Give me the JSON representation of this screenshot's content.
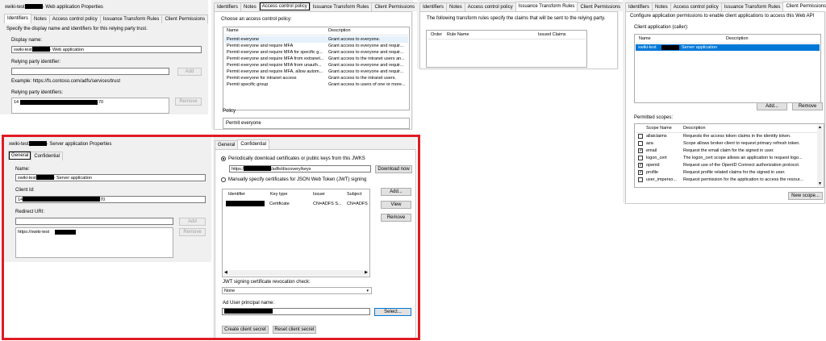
{
  "webapp": {
    "title_prefix": "xwiki-test",
    "title_suffix": "- Web application Properties",
    "tabs": [
      "Identifiers",
      "Notes",
      "Access control policy",
      "Issuance Transform Rules",
      "Client Permissions"
    ],
    "intro": "Specify the display name and identifiers for this relying party trust.",
    "display_name_label": "Display name:",
    "display_name_prefix": "xwiki-test",
    "display_name_suffix": "- Web application",
    "rp_identifier_label": "Relying party identifier:",
    "add_label": "Add",
    "example": "Example: https://fs.contoso.com/adfs/services/trust",
    "rp_identifiers_label": "Relying party identifiers:",
    "id_prefix": "14",
    "id_suffix": "70",
    "remove_label": "Remove"
  },
  "acp": {
    "tabs": [
      "Identifiers",
      "Notes",
      "Access control policy",
      "Issuance Transform Rules",
      "Client Permissions"
    ],
    "choose": "Choose an access control policy:",
    "col_name": "Name",
    "col_desc": "Description",
    "rows": [
      {
        "name": "Permit everyone",
        "desc": "Grant access to everyone."
      },
      {
        "name": "Permit everyone and require MFA",
        "desc": "Grant access to everyone and requir..."
      },
      {
        "name": "Permit everyone and require MFA for specific g...",
        "desc": "Grant access to everyone and requir..."
      },
      {
        "name": "Permit everyone and require MFA from extranet...",
        "desc": "Grant access to the intranet users an..."
      },
      {
        "name": "Permit everyone and require MFA from unauth...",
        "desc": "Grant access to everyone and requir..."
      },
      {
        "name": "Permit everyone and require MFA, allow autom...",
        "desc": "Grant access to everyone and requir..."
      },
      {
        "name": "Permit everyone for intranet access",
        "desc": "Grant access to the intranet users."
      },
      {
        "name": "Permit specific group",
        "desc": "Grant access to users of one or more..."
      }
    ],
    "policy_label": "Policy",
    "policy_value": "Permit everyone"
  },
  "itr": {
    "tabs": [
      "Identifiers",
      "Notes",
      "Access control policy",
      "Issuance Transform Rules",
      "Client Permissions"
    ],
    "intro": "The following transform rules specify the claims that will be sent to the relying party.",
    "col_order": "Order",
    "col_rule": "Rule Name",
    "col_claims": "Issued Claims"
  },
  "cp": {
    "tabs": [
      "Identifiers",
      "Notes",
      "Access control policy",
      "Issuance Transform Rules",
      "Client Permissions"
    ],
    "intro": "Configure application permissions to enable client applications to access this Web API",
    "client_label": "Client application (caller):",
    "col_name": "Name",
    "col_desc": "Description",
    "client_prefix": "xwiki-test",
    "client_suffix": "Server application",
    "add_label": "Add...",
    "remove_label": "Remove",
    "scopes_label": "Permitted scopes:",
    "col_scope": "Scope Name",
    "scopes": [
      {
        "name": "allatclaims",
        "desc": "Requests the access token claims in the identity token.",
        "checked": false
      },
      {
        "name": "aza",
        "desc": "Scope allows broker client to request primary refresh token.",
        "checked": false
      },
      {
        "name": "email",
        "desc": "Request the email claim for the signed in user.",
        "checked": true
      },
      {
        "name": "logon_cert",
        "desc": "The logon_cert scope allows an application to request logo...",
        "checked": false
      },
      {
        "name": "openid",
        "desc": "Request use of the OpenID Connect authorization protocol.",
        "checked": true
      },
      {
        "name": "profile",
        "desc": "Request profile related claims for the signed in user.",
        "checked": true
      },
      {
        "name": "user_imperso...",
        "desc": "Request permission for the application to access the resour...",
        "checked": false
      }
    ],
    "new_scope_label": "New scope..."
  },
  "server": {
    "title_prefix": "xwiki-test",
    "title_suffix": "- Server application Properties",
    "tabs": [
      "General",
      "Confidential"
    ],
    "name_label": "Name:",
    "name_prefix": "xwiki-test",
    "name_suffix": "- Server application",
    "client_id_label": "Client Id:",
    "client_id_prefix": "14",
    "client_id_suffix": "70",
    "redirect_label": "Redirect URI:",
    "add_label": "Add",
    "remove_label": "Remove",
    "redirect_value": "https://xwiki-test"
  },
  "confidential": {
    "tabs": [
      "General",
      "Confidential"
    ],
    "radio1": "Periodically download certificates or public keys from this JWKS",
    "jwks_prefix": "https:/",
    "jwks_suffix": "/adfs/discovery/keys",
    "download_label": "Download now",
    "radio2": "Manually specify certificates for JSON Web Token (JWT) signing",
    "col_identifier": "Identifier",
    "col_keytype": "Key type",
    "col_issuer": "Issuer",
    "col_subject": "Subject",
    "cert_keytype": "Certificate",
    "cert_issuer": "CN=ADFS S...",
    "cert_subject": "CN=ADFS S",
    "add_label": "Add...",
    "view_label": "View",
    "remove_label": "Remove",
    "revocation_label": "JWT signing certificate revocation check:",
    "revocation_value": "None",
    "upn_label": "Ad User principal name:",
    "select_label": "Select...",
    "create_secret": "Create client secret",
    "reset_secret": "Reset client secret"
  },
  "colors": {
    "highlight": "#e01b24",
    "selection": "#0078d7"
  }
}
